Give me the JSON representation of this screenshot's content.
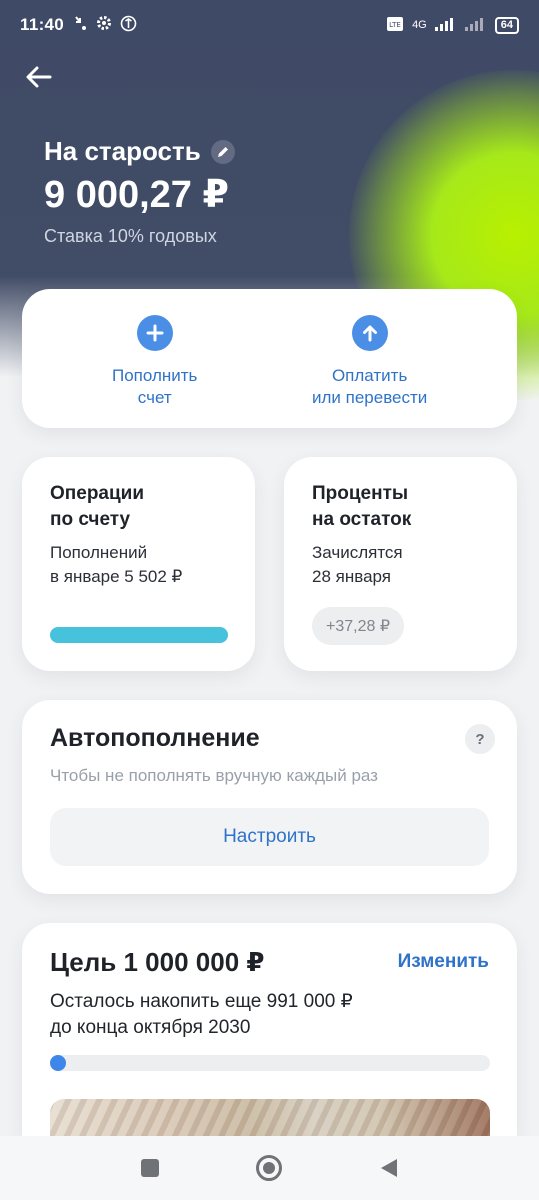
{
  "status_bar": {
    "time": "11:40",
    "network": "4G",
    "battery": "64",
    "icons": [
      "missed-call-icon",
      "gear-icon",
      "vpn-icon",
      "volte-icon",
      "signal-icon",
      "wifi-signal-icon"
    ]
  },
  "header": {
    "account_name": "На старость",
    "balance": "9 000,27 ₽",
    "rate": "Ставка 10% годовых"
  },
  "actions": [
    {
      "label": "Пополнить\nсчет",
      "icon": "plus-icon"
    },
    {
      "label": "Оплатить\nили перевести",
      "icon": "arrow-up-icon"
    }
  ],
  "operations_card": {
    "title": "Операции\nпо счету",
    "text": "Пополнений\nв январе 5 502 ₽"
  },
  "interest_card": {
    "title": "Проценты\nна остаток",
    "text": "Зачислятся\n28 января",
    "amount": "+37,28 ₽"
  },
  "autopay_card": {
    "title": "Автопополнение",
    "subtitle": "Чтобы не пополнять вручную каждый раз",
    "help": "?",
    "button": "Настроить"
  },
  "goal_card": {
    "title": "Цель 1 000 000 ₽",
    "edit": "Изменить",
    "text": "Осталось накопить еще 991 000 ₽\nдо конца октября 2030",
    "progress_fraction": 0.009
  },
  "colors": {
    "header_bg": "#414c66",
    "accent_green": "#a6e91a",
    "link_blue": "#2f73c9",
    "progress_cyan": "#47c2dc"
  },
  "nav_bar": [
    "square-recents-icon",
    "circle-home-icon",
    "triangle-back-icon"
  ]
}
